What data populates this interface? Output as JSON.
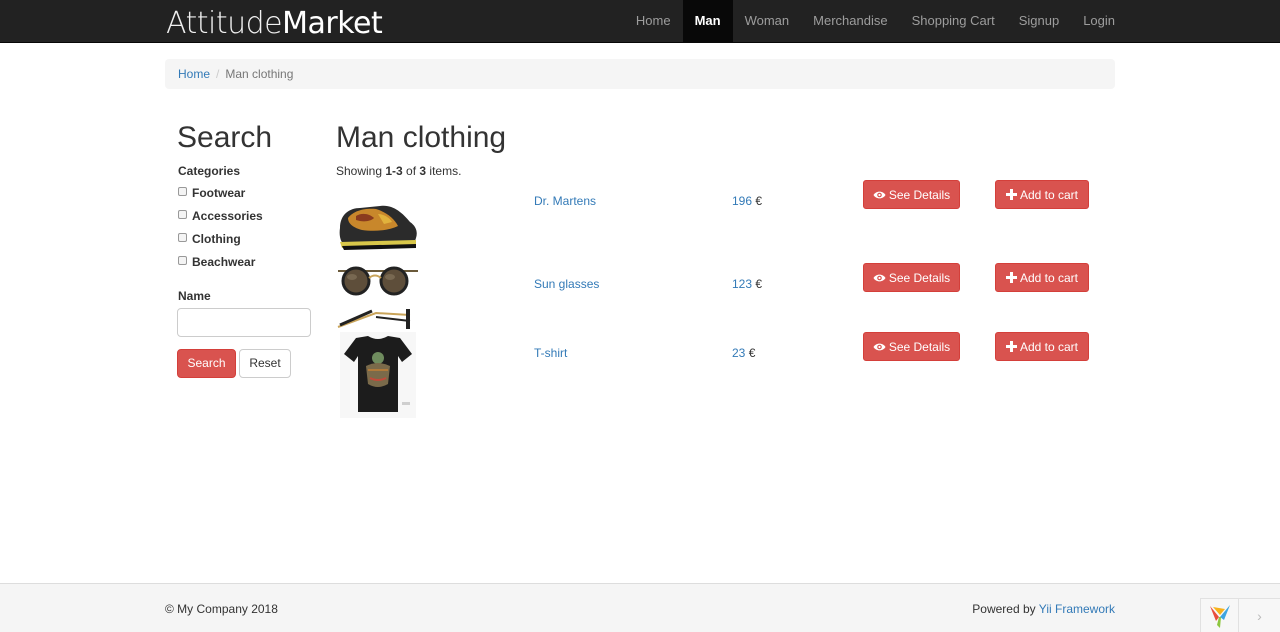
{
  "brand": {
    "light": "Attitude",
    "bold": "Market"
  },
  "nav": [
    {
      "label": "Home",
      "active": false
    },
    {
      "label": "Man",
      "active": true
    },
    {
      "label": "Woman",
      "active": false
    },
    {
      "label": "Merchandise",
      "active": false
    },
    {
      "label": "Shopping Cart",
      "active": false
    },
    {
      "label": "Signup",
      "active": false
    },
    {
      "label": "Login",
      "active": false
    }
  ],
  "breadcrumb": {
    "home": "Home",
    "separator": "/",
    "current": "Man clothing"
  },
  "sidebar": {
    "title": "Search",
    "categories_label": "Categories",
    "categories": [
      "Footwear",
      "Accessories",
      "Clothing",
      "Beachwear"
    ],
    "name_label": "Name",
    "name_value": "",
    "search_button": "Search",
    "reset_button": "Reset"
  },
  "main": {
    "title": "Man clothing",
    "summary": {
      "prefix": "Showing ",
      "range": "1-3",
      "of": " of ",
      "total": "3",
      "suffix": " items."
    },
    "products": [
      {
        "name": "Dr. Martens",
        "price": "196",
        "currency": "€",
        "image": "shoe",
        "details": "See Details",
        "cart": "Add to cart"
      },
      {
        "name": "Sun glasses",
        "price": "123",
        "currency": "€",
        "image": "sunglasses",
        "details": "See Details",
        "cart": "Add to cart"
      },
      {
        "name": "T-shirt",
        "price": "23",
        "currency": "€",
        "image": "tshirt",
        "details": "See Details",
        "cart": "Add to cart"
      }
    ]
  },
  "footer": {
    "copyright": "© My Company 2018",
    "powered_prefix": "Powered by ",
    "powered_link": "Yii Framework"
  },
  "colors": {
    "navbar": "#222222",
    "danger": "#d9534f",
    "link": "#337ab7"
  }
}
